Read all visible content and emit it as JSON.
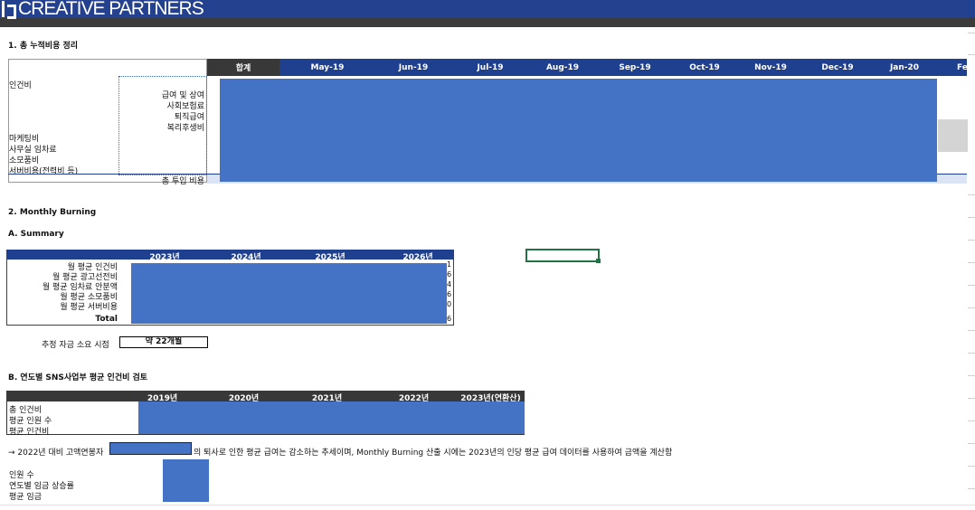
{
  "brand": {
    "name": "CREATIVE PARTNERS"
  },
  "section1": {
    "title": "1. 총 누적비용 정리",
    "total_header": "합계",
    "months": [
      "May-19",
      "Jun-19",
      "Jul-19",
      "Aug-19",
      "Sep-19",
      "Oct-19",
      "Nov-19",
      "Dec-19",
      "Jan-20",
      "Fe"
    ],
    "labels": {
      "personnel": "인건비",
      "marketing": "마케팅비",
      "office_rent": "사무실 임차료",
      "supplies": "소모품비",
      "server": "서버비용(전력비 등)"
    },
    "sub_labels": [
      "급여 및 상여",
      "사회보험료",
      "퇴직급여",
      "복리후생비"
    ],
    "total_label": "총 투입 비용"
  },
  "section2": {
    "title": "2. Monthly Burning",
    "summary_title": "A. Summary",
    "years": [
      "2023년",
      "2024년",
      "2025년",
      "2026년"
    ],
    "rows": [
      "월 평균 인건비",
      "월 평균 광고선전비",
      "월 평균 임차료 안분액",
      "월 평균 소모품비",
      "월 평균 서버비용",
      "Total"
    ],
    "tail_digits": [
      "1",
      "6",
      "4",
      "6",
      "0",
      "6"
    ],
    "estimate_label": "추정 자금 소요 시점",
    "estimate_value": "약 22개월"
  },
  "sectionB": {
    "title": "B. 연도별 SNS사업부 평균 인건비 검토",
    "years": [
      "2019년",
      "2020년",
      "2021년",
      "2022년",
      "2023년(연환산)"
    ],
    "rows": [
      "총 인건비",
      "평균 인원 수",
      "평균 인건비"
    ],
    "note_prefix": "→ 2022년 대비 고액연봉자",
    "note_suffix": "의 퇴사로 인한 평균 급여는 감소하는 추세이며, Monthly Burning 산출 시에는 2023년의 인당 평균 급여 데이터를 사용하여 금액을 계산함",
    "extra_rows": [
      "인원 수",
      "연도별 임금 상승률",
      "평균 임금"
    ]
  }
}
